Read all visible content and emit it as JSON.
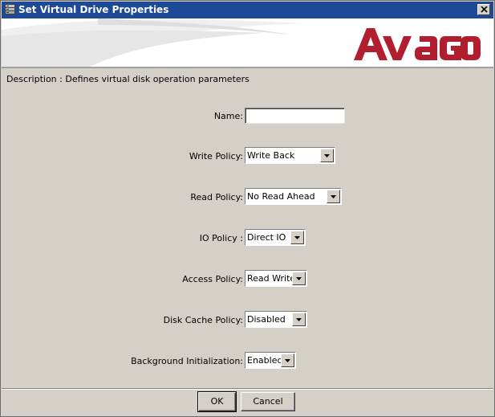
{
  "window": {
    "title": "Set Virtual Drive Properties",
    "close_label": "×"
  },
  "banner": {
    "logo_text": "Avago",
    "logo_color": "#b01e2f"
  },
  "description": "Description : Defines virtual disk operation parameters",
  "fields": {
    "name": {
      "label": "Name:",
      "value": ""
    },
    "write_policy": {
      "label": "Write Policy:",
      "value": "Write Back"
    },
    "read_policy": {
      "label": "Read Policy:",
      "value": "No Read Ahead"
    },
    "io_policy": {
      "label": "IO Policy :",
      "value": "Direct IO"
    },
    "access_policy": {
      "label": "Access Policy:",
      "value": "Read Write"
    },
    "disk_cache_policy": {
      "label": "Disk Cache Policy:",
      "value": "Disabled"
    },
    "background_init": {
      "label": "Background Initialization:",
      "value": "Enabled"
    }
  },
  "buttons": {
    "ok": "OK",
    "cancel": "Cancel"
  }
}
